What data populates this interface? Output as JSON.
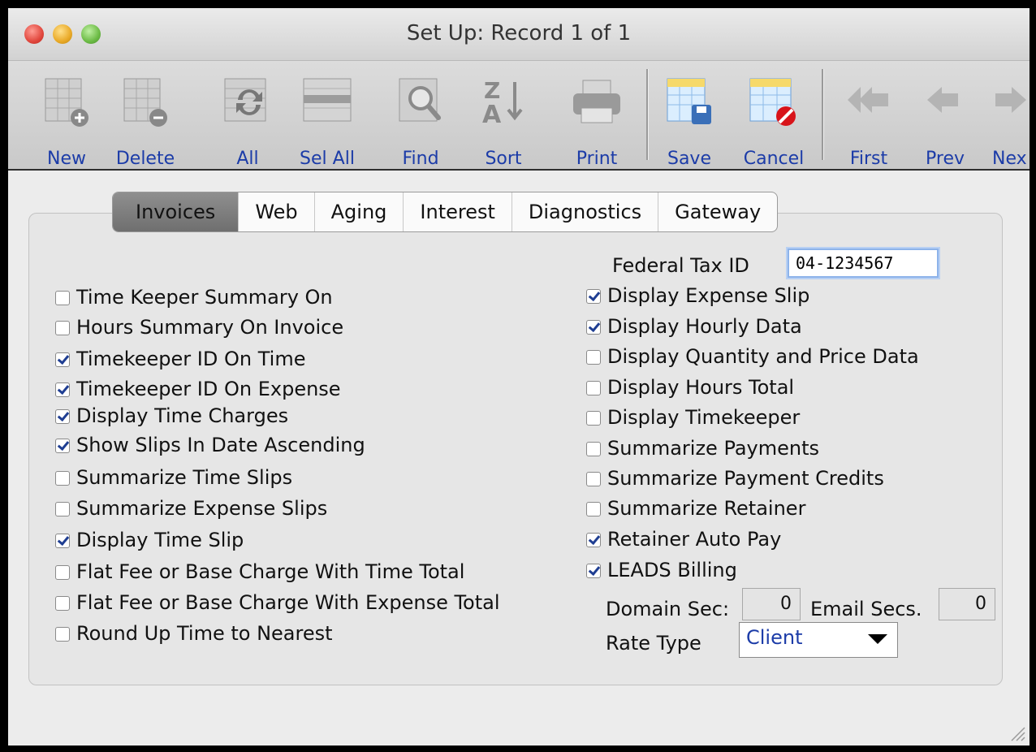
{
  "window": {
    "title": "Set Up: Record 1 of 1"
  },
  "toolbar": {
    "new": "New",
    "delete": "Delete",
    "all": "All",
    "sel_all": "Sel All",
    "find": "Find",
    "sort": "Sort",
    "print": "Print",
    "save": "Save",
    "cancel": "Cancel",
    "first": "First",
    "prev": "Prev",
    "next": "Nex"
  },
  "tabs": [
    "Invoices",
    "Web",
    "Aging",
    "Interest",
    "Diagnostics",
    "Gateway"
  ],
  "active_tab": "Invoices",
  "federal_tax": {
    "label": "Federal Tax ID",
    "value": "04-1234567"
  },
  "left_options": [
    {
      "label": "Time Keeper Summary On",
      "checked": false
    },
    {
      "label": "Hours Summary On Invoice",
      "checked": false
    },
    {
      "label": "Timekeeper ID On Time",
      "checked": true
    },
    {
      "label": "Timekeeper ID On Expense",
      "checked": true
    },
    {
      "label": "Display Time Charges",
      "checked": true
    },
    {
      "label": "Show Slips In Date Ascending",
      "checked": true
    },
    {
      "label": "Summarize Time Slips",
      "checked": false
    },
    {
      "label": "Summarize Expense Slips",
      "checked": false
    },
    {
      "label": "Display Time Slip",
      "checked": true
    },
    {
      "label": "Flat Fee or Base Charge With Time Total",
      "checked": false
    },
    {
      "label": "Flat Fee or Base Charge With Expense Total",
      "checked": false
    },
    {
      "label": "Round Up Time to Nearest",
      "checked": false
    }
  ],
  "right_options": [
    {
      "label": "Display Expense Slip",
      "checked": true
    },
    {
      "label": "Display Hourly Data",
      "checked": true
    },
    {
      "label": "Display Quantity and Price Data",
      "checked": false
    },
    {
      "label": "Display Hours Total",
      "checked": false
    },
    {
      "label": "Display Timekeeper",
      "checked": false
    },
    {
      "label": "Summarize Payments",
      "checked": false
    },
    {
      "label": "Summarize Payment Credits",
      "checked": false
    },
    {
      "label": "Summarize Retainer",
      "checked": false
    },
    {
      "label": "Retainer Auto Pay",
      "checked": true
    },
    {
      "label": "LEADS Billing",
      "checked": true
    }
  ],
  "domain_secs": {
    "label": "Domain Sec:",
    "value": "0"
  },
  "email_secs": {
    "label": "Email Secs.",
    "value": "0"
  },
  "rate_type": {
    "label": "Rate Type",
    "value": "Client"
  },
  "colors": {
    "label_blue": "#1c3ca8",
    "check_blue": "#1f3e92"
  }
}
